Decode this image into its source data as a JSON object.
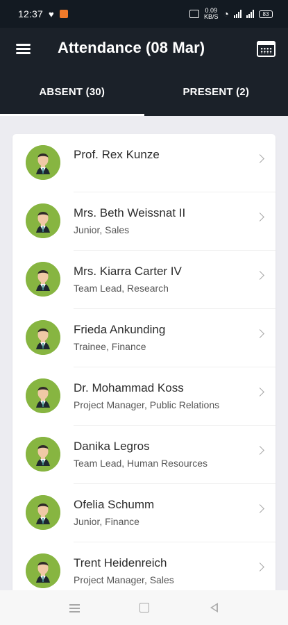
{
  "status_bar": {
    "time": "12:37",
    "heart_icon": "heart-icon",
    "app_notification_icon": "app-notification-icon",
    "alarm_icon": "alarm-icon",
    "data_speed_top": "0.09",
    "data_speed_bottom": "KB/S",
    "wifi_icon": "wifi-icon",
    "signal_icon": "signal-icon",
    "battery": "83"
  },
  "app_bar": {
    "title": "Attendance (08 Mar)",
    "menu_icon": "menu-icon",
    "calendar_icon": "calendar-icon"
  },
  "tabs": [
    {
      "label": "ABSENT (30)",
      "selected": true
    },
    {
      "label": "PRESENT (2)",
      "selected": false
    }
  ],
  "employees": [
    {
      "name": "Prof. Rex Kunze",
      "role": ""
    },
    {
      "name": "Mrs. Beth Weissnat II",
      "role": "Junior, Sales"
    },
    {
      "name": "Mrs. Kiarra Carter IV",
      "role": "Team Lead, Research"
    },
    {
      "name": "Frieda Ankunding",
      "role": "Trainee, Finance"
    },
    {
      "name": "Dr. Mohammad Koss",
      "role": "Project Manager, Public Relations"
    },
    {
      "name": "Danika Legros",
      "role": "Team Lead, Human Resources"
    },
    {
      "name": "Ofelia Schumm",
      "role": "Junior, Finance"
    },
    {
      "name": "Trent Heidenreich",
      "role": "Project Manager, Sales"
    }
  ],
  "bottom_nav": {
    "menu_icon": "recent-apps-icon",
    "home_icon": "home-icon",
    "back_icon": "back-icon"
  },
  "colors": {
    "header_bg": "#1b2129",
    "status_bg": "#131a22",
    "page_bg": "#ececf1",
    "avatar_bg": "#87b541"
  }
}
